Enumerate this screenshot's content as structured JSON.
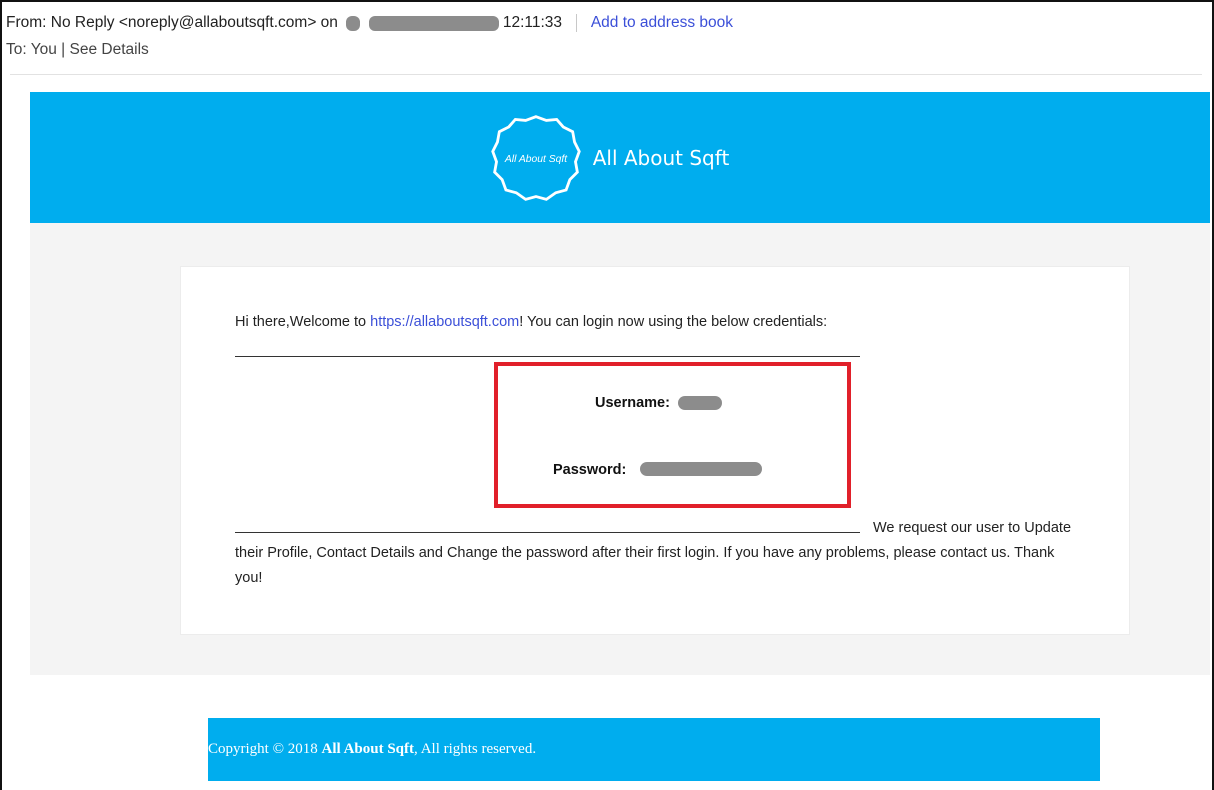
{
  "header": {
    "from_prefix": "From: No Reply <noreply@allaboutsqft.com> on",
    "time": "12:11:33",
    "add_to_address_book": "Add to address book",
    "to_label": "To: You",
    "see_details": "See Details"
  },
  "banner": {
    "brand_name": "All About Sqft",
    "logo_text": "All About Sqft",
    "background_color": "#00adee"
  },
  "body": {
    "welcome_prefix": "Hi there,Welcome to",
    "welcome_link": "https://allaboutsqft.com",
    "welcome_suffix": "! You can login now using the below credentials:",
    "username_label": "Username:",
    "password_label": "Password:",
    "request_text": "We request our user to Update their Profile, Contact Details and Change the password after their first login. If you have any problems, please contact us. Thank you!"
  },
  "footer": {
    "copyright_prefix": "Copyright © 2018",
    "brand_bold": "All About Sqft",
    "rights": ", All rights reserved."
  },
  "colors": {
    "accent": "#00adee",
    "highlight_box": "#e1202a",
    "link": "#3b4fd8"
  }
}
